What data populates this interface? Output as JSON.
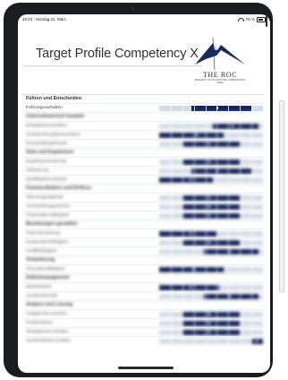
{
  "status_bar": {
    "time": "15:04 · Montag 21. März",
    "battery": "76 %"
  },
  "header": {
    "title": "Target Profile Competency X",
    "logo_text": "THE ROC",
    "logo_subtext": "RESEARCH ON OCCUPATIONAL COMPETENCIES GMBH"
  },
  "profile": {
    "first_section": "Führen und Entscheiden",
    "sections": [
      {
        "heading": "Unternehmerisch handeln",
        "rows": [
          {
            "label": "Führungsverhalten",
            "bar": [
              0.31,
              0.89
            ],
            "dot": 0.56
          },
          {
            "label": "Delegationsverhalten",
            "bar": [
              0.52,
              0.96
            ],
            "dot": 0.71
          },
          {
            "label": "Verantwortungsbewusstsein",
            "bar": [
              0.0,
              0.62
            ],
            "dot": 0.36
          },
          {
            "label": "Entscheidungsfreude",
            "bar": [
              0.22,
              0.78
            ],
            "dot": 0.48
          }
        ]
      },
      {
        "heading": "Ziele und Ergebnisse",
        "rows": [
          {
            "label": "Ergebnisorientierung",
            "bar": [
              0.22,
              0.78
            ],
            "dot": 0.48
          },
          {
            "label": "Zielsetzung",
            "bar": [
              0.31,
              0.89
            ],
            "dot": 0.56
          },
          {
            "label": "Qualitätsbewusstsein",
            "bar": [
              0.0,
              0.52
            ],
            "dot": 0.3
          }
        ]
      },
      {
        "heading": "Kommunikation und Einfluss",
        "rows": [
          {
            "label": "Überzeugungskraft",
            "bar": [
              0.22,
              0.78
            ],
            "dot": 0.48
          },
          {
            "label": "Verhandlungsgeschick",
            "bar": [
              0.22,
              0.78
            ],
            "dot": 0.48
          },
          {
            "label": "Präsentationsfähigkeit",
            "bar": [
              0.22,
              0.78
            ],
            "dot": 0.48
          }
        ]
      },
      {
        "heading": "Beziehungen gestalten",
        "rows": [
          {
            "label": "Teamorientierung",
            "bar": [
              0.0,
              0.55
            ],
            "dot": 0.3
          },
          {
            "label": "Kooperationsfähigkeit",
            "bar": [
              0.22,
              0.78
            ],
            "dot": 0.48
          },
          {
            "label": "Konfliktfähigkeit",
            "bar": [
              0.43,
              0.96
            ],
            "dot": 0.68
          }
        ]
      },
      {
        "heading": "Veränderung",
        "rows": [
          {
            "label": "Innovationsfähigkeit",
            "bar": [
              0.0,
              0.62
            ],
            "dot": 0.33
          }
        ]
      },
      {
        "heading": "Selbstmanagement",
        "rows": [
          {
            "label": "Belastbarkeit",
            "bar": [
              0.0,
              0.58
            ],
            "dot": 0.3
          },
          {
            "label": "Lernbereitschaft",
            "bar": [
              0.43,
              0.96
            ],
            "dot": 0.68
          }
        ]
      },
      {
        "heading": "Analyse und Lösung",
        "rows": [
          {
            "label": "Analytisches Denken",
            "bar": [
              0.22,
              0.78
            ],
            "dot": 0.48
          },
          {
            "label": "Problemlösen",
            "bar": [
              0.22,
              0.78
            ],
            "dot": 0.48
          },
          {
            "label": "Strategisches Denken",
            "bar": [
              0.22,
              0.78
            ],
            "dot": 0.48
          },
          {
            "label": "Ganzheitliches Denken",
            "bar": [
              0.89,
              1.0
            ],
            "dot": 0.94
          }
        ]
      }
    ]
  },
  "colors": {
    "bar": "#15255a",
    "scale_bg": "#d5dbe6",
    "accent_navy": "#1a2a5e"
  }
}
